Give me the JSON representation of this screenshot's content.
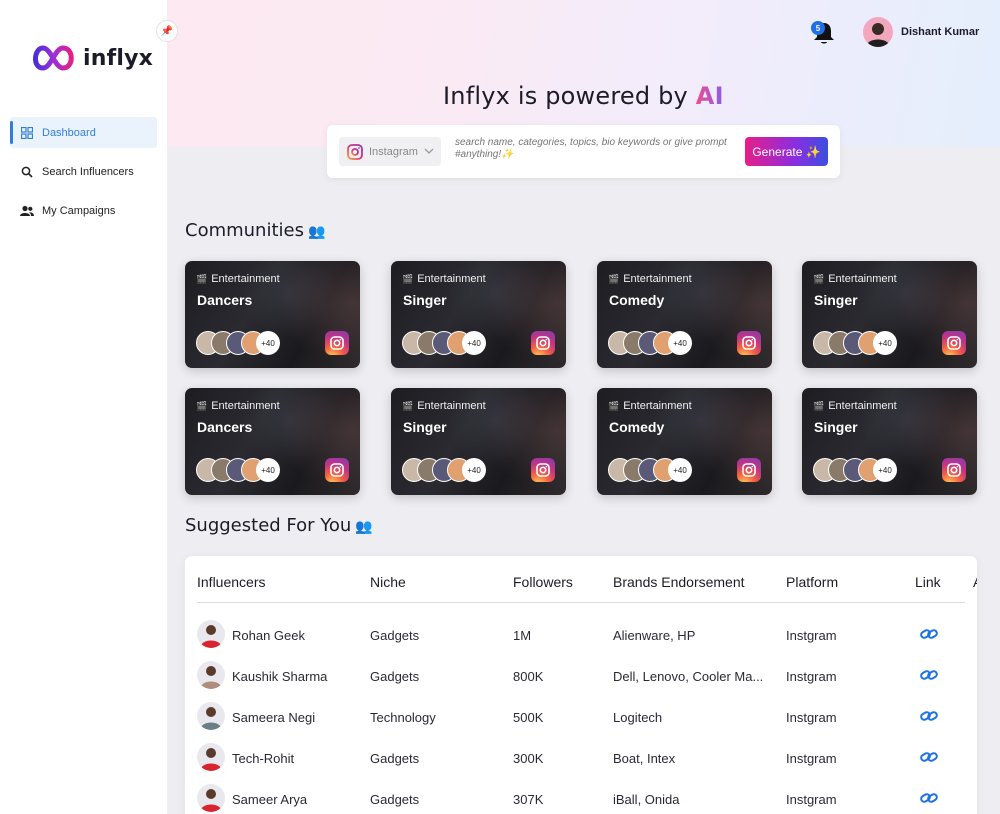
{
  "brand": {
    "name": "inflyx"
  },
  "sidebar": {
    "items": [
      {
        "label": "Dashboard",
        "icon": "dashboard-grid-icon",
        "active": true
      },
      {
        "label": "Search Influencers",
        "icon": "search-icon",
        "active": false
      },
      {
        "label": "My Campaigns",
        "icon": "people-icon",
        "active": false
      }
    ]
  },
  "header": {
    "notifications_count": "5",
    "user_name": "Dishant Kumar"
  },
  "hero": {
    "headline_prefix": "Inflyx is powered by ",
    "headline_ai": "AI"
  },
  "search": {
    "platform": "Instagram",
    "placeholder": "search name, categories, topics, bio keywords or give prompt #anything!✨",
    "button_label": "Generate ✨"
  },
  "communities": {
    "title": "Communities",
    "cards": [
      {
        "category": "Entertainment",
        "title": "Dancers",
        "more": "+40"
      },
      {
        "category": "Entertainment",
        "title": "Singer",
        "more": "+40"
      },
      {
        "category": "Entertainment",
        "title": "Comedy",
        "more": "+40"
      },
      {
        "category": "Entertainment",
        "title": "Singer",
        "more": "+40"
      },
      {
        "category": "Entertainment",
        "title": "Dancers",
        "more": "+40"
      },
      {
        "category": "Entertainment",
        "title": "Singer",
        "more": "+40"
      },
      {
        "category": "Entertainment",
        "title": "Comedy",
        "more": "+40"
      },
      {
        "category": "Entertainment",
        "title": "Singer",
        "more": "+40"
      }
    ]
  },
  "suggested": {
    "title": "Suggested For You",
    "columns": [
      "Influencers",
      "Niche",
      "Followers",
      "Brands Endorsement",
      "Platform",
      "Link",
      "A"
    ],
    "rows": [
      {
        "name": "Rohan Geek",
        "niche": "Gadgets",
        "followers": "1M",
        "brands": "Alienware, HP",
        "platform": "Instgram"
      },
      {
        "name": "Kaushik Sharma",
        "niche": "Gadgets",
        "followers": "800K",
        "brands": "Dell, Lenovo, Cooler Ma...",
        "platform": "Instgram"
      },
      {
        "name": "Sameera Negi",
        "niche": "Technology",
        "followers": "500K",
        "brands": "Logitech",
        "platform": "Instgram"
      },
      {
        "name": "Tech-Rohit",
        "niche": "Gadgets",
        "followers": "300K",
        "brands": "Boat, Intex",
        "platform": "Instgram"
      },
      {
        "name": "Sameer Arya",
        "niche": "Gadgets",
        "followers": "307K",
        "brands": "iBall, Onida",
        "platform": "Instgram"
      }
    ]
  },
  "colors": {
    "accent": "#2f7fd8",
    "brand_pink": "#e61e8a",
    "brand_purple": "#8b2ee0",
    "link_blue": "#1e6fe8"
  }
}
